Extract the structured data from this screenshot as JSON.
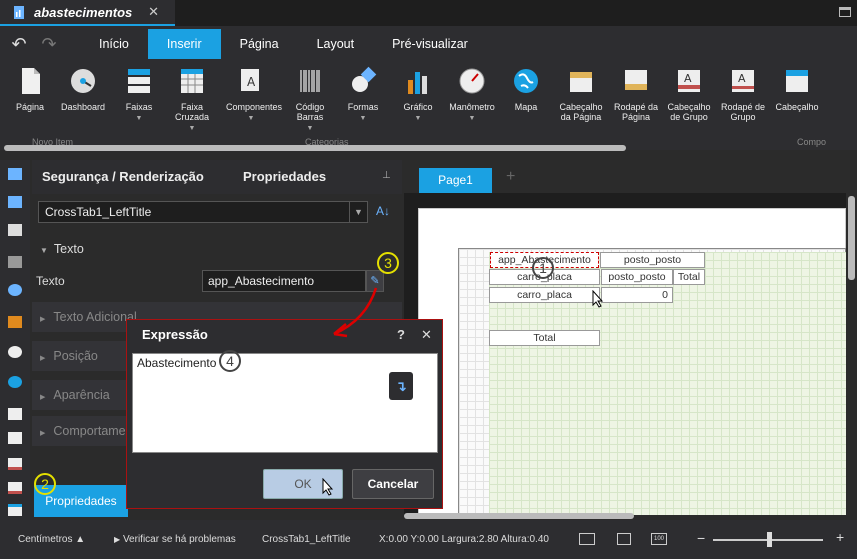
{
  "document_tab": {
    "title": "abastecimentos",
    "close": "✕"
  },
  "menu": {
    "items": [
      "Início",
      "Inserir",
      "Página",
      "Layout",
      "Pré-visualizar"
    ],
    "active": "Inserir"
  },
  "ribbon": {
    "buttons": [
      {
        "label": "Página",
        "icon": "page-icon"
      },
      {
        "label": "Dashboard",
        "icon": "dashboard-icon"
      },
      {
        "label": "Faixas",
        "icon": "bands-icon",
        "dropdown": true
      },
      {
        "label": "Faixa Cruzada",
        "icon": "crossband-icon",
        "dropdown": true
      },
      {
        "label": "Componentes",
        "icon": "components-icon",
        "dropdown": true
      },
      {
        "label": "Código Barras",
        "icon": "barcode-icon",
        "dropdown": true
      },
      {
        "label": "Formas",
        "icon": "shapes-icon",
        "dropdown": true
      },
      {
        "label": "Gráfico",
        "icon": "chart-icon",
        "dropdown": true
      },
      {
        "label": "Manômetro",
        "icon": "gauge-icon",
        "dropdown": true
      },
      {
        "label": "Mapa",
        "icon": "map-icon"
      },
      {
        "label": "Cabeçalho da Página",
        "icon": "page-header-icon"
      },
      {
        "label": "Rodapé da Página",
        "icon": "page-footer-icon"
      },
      {
        "label": "Cabeçalho de Grupo",
        "icon": "group-header-icon"
      },
      {
        "label": "Rodapé de Grupo",
        "icon": "group-footer-icon"
      },
      {
        "label": "Cabeçalho",
        "icon": "header-icon"
      }
    ],
    "groups": [
      "Novo Item",
      "Categorias",
      "Compo"
    ]
  },
  "properties_panel": {
    "tabs": [
      "Segurança / Renderização",
      "Propriedades"
    ],
    "pin": "📌",
    "component": "CrossTab1_LeftTitle",
    "section_text": "Texto",
    "text_label": "Texto",
    "text_value": "app_Abastecimento",
    "sections": [
      "Texto Adicional",
      "Posição",
      "Aparência",
      "Comportamento"
    ],
    "button": "Propriedades"
  },
  "dialog": {
    "title": "Expressão",
    "help": "?",
    "close": "✕",
    "expression": "Abastecimento",
    "ok": "OK",
    "cancel": "Cancelar"
  },
  "designer": {
    "page_tab": "Page1",
    "add_tab": "+",
    "cells": [
      "app_Abastecimento",
      "posto_posto",
      "carro_placa",
      "posto_posto",
      "Total",
      "carro_placa",
      "0",
      "Total"
    ]
  },
  "badges": [
    "1",
    "2",
    "3",
    "4"
  ],
  "status": {
    "units": "Centímetros",
    "check": "Verificar se há problemas",
    "component": "CrossTab1_LeftTitle",
    "coords": "X:0.00 Y:0.00 Largura:2.80 Altura:0.40",
    "zoom_minus": "−",
    "zoom_plus": "+"
  }
}
